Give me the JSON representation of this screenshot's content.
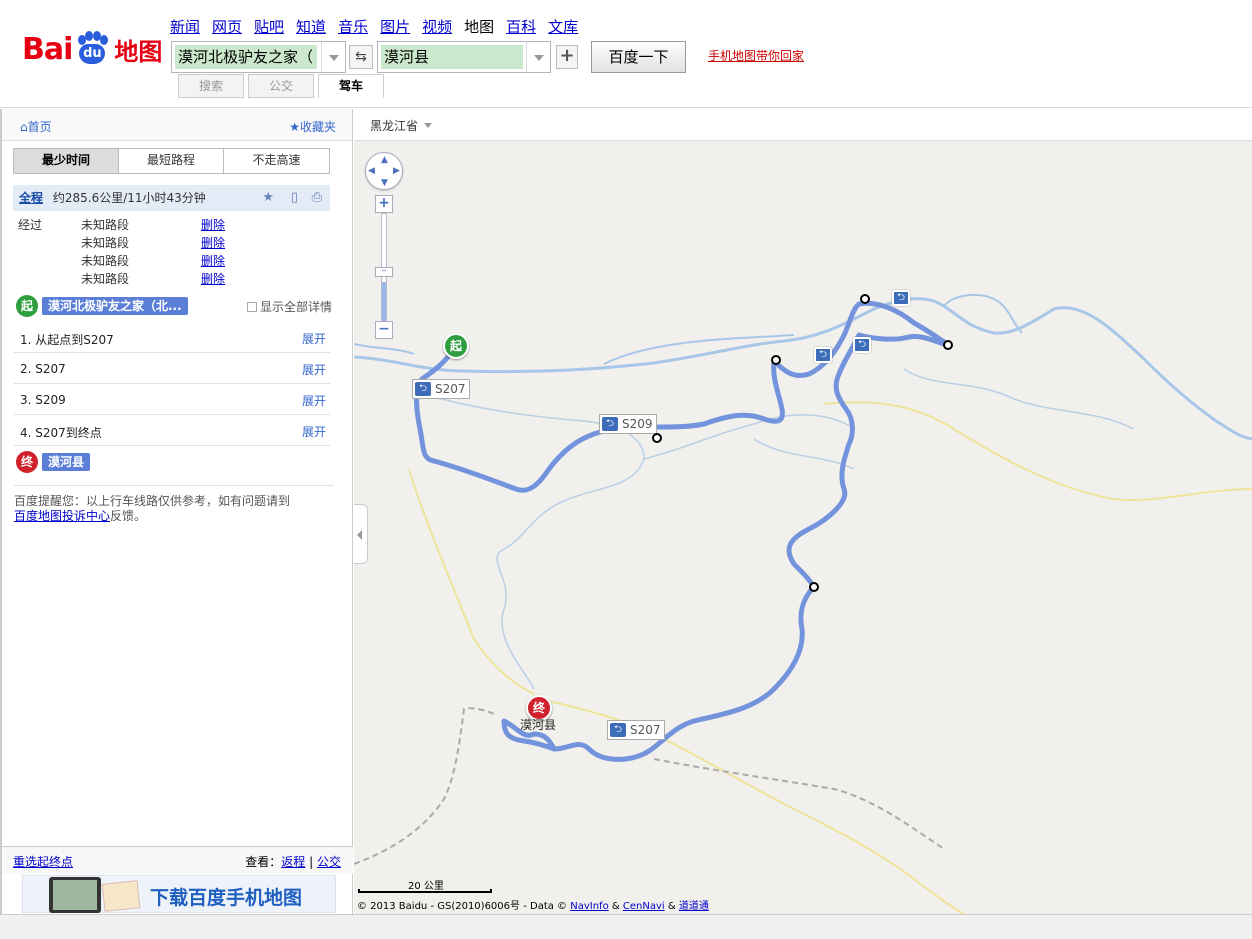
{
  "header": {
    "logo_text_a": "Bai",
    "logo_text_du": "du",
    "logo_text_map": "地图",
    "nav": [
      "新闻",
      "网页",
      "贴吧",
      "知道",
      "音乐",
      "图片",
      "视频",
      "地图",
      "百科",
      "文库"
    ],
    "nav_active": "地图",
    "from_value": "漠河北极驴友之家（",
    "to_value": "漠河县",
    "search_button": "百度一下",
    "mobile_link": "手机地图带你回家",
    "mode_tabs": [
      "搜索",
      "公交",
      "驾车"
    ],
    "mode_active": "驾车"
  },
  "left": {
    "home": "首页",
    "favorites": "收藏夹",
    "route_tabs": [
      "最少时间",
      "最短路程",
      "不走高速"
    ],
    "summary_all": "全程",
    "summary_text": "约285.6公里/11小时43分钟",
    "via_label": "经过",
    "via_items": [
      {
        "name": "未知路段",
        "action": "删除"
      },
      {
        "name": "未知路段",
        "action": "删除"
      },
      {
        "name": "未知路段",
        "action": "删除"
      },
      {
        "name": "未知路段",
        "action": "删除"
      }
    ],
    "start_badge": "起",
    "start_name": "漠河北极驴友之家（北...",
    "show_all_details": "显示全部详情",
    "steps": [
      {
        "text": "1. 从起点到S207",
        "action": "展开"
      },
      {
        "text": "2. S207",
        "action": "展开"
      },
      {
        "text": "3. S209",
        "action": "展开"
      },
      {
        "text": "4. S207到终点",
        "action": "展开"
      }
    ],
    "end_badge": "终",
    "end_name": "漠河县",
    "notice_text": "百度提醒您：以上行车线路仅供参考，如有问题请到",
    "notice_link": "百度地图投诉中心",
    "notice_tail": "反馈。",
    "reselect": "重选起终点",
    "view_label": "查看：",
    "view_return": "返程",
    "view_sep": "|",
    "view_transit": "公交",
    "banner_text": "下载百度手机地图"
  },
  "map": {
    "province": "黑龙江省",
    "road_labels": [
      "S207",
      "S209",
      "S207"
    ],
    "start_pin": "起",
    "end_pin": "终",
    "city_label": "漠河县",
    "scale_label": "20 公里",
    "copyright_text": "© 2013 Baidu - GS(2010)6006号 - Data ©",
    "copyright_navinfo": "NavInfo",
    "copyright_amp1": "&",
    "copyright_cennavi": "CenNavi",
    "copyright_amp2": "&",
    "copyright_daodao": "道道通",
    "route_color": "#6b8fd9",
    "river_color": "#a8c7e8",
    "road_color": "#f2e69a"
  }
}
